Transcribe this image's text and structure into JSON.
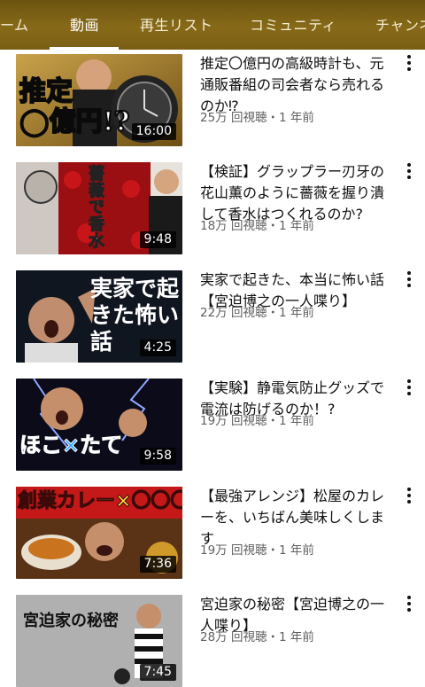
{
  "tabs": [
    {
      "label": "ーム"
    },
    {
      "label": "動画"
    },
    {
      "label": "再生リスト"
    },
    {
      "label": "コミュニティ"
    },
    {
      "label": "チャンネ"
    }
  ],
  "videos": [
    {
      "title": "推定〇億円の高級時計も、元通販番組の司会者なら売れるのか⁉",
      "meta": "25万 回視聴・1 年前",
      "duration": "16:00",
      "thumb_text": "推定\n◯億円!?"
    },
    {
      "title": "【検証】グラップラー刃牙の花山薫のように薔薇を握り潰して香水はつくれるのか?",
      "meta": "18万 回視聴・1 年前",
      "duration": "9:48",
      "thumb_text": "薔薇で香水"
    },
    {
      "title": "実家で起きた、本当に怖い話【宮迫博之の一人喋り】",
      "meta": "22万 回視聴・1 年前",
      "duration": "4:25",
      "thumb_text": "実家で起きた怖い話"
    },
    {
      "title": "【実験】静電気防止グッズで電流は防げるのか！?",
      "meta": "19万 回視聴・1 年前",
      "duration": "9:58",
      "thumb_text": "ほこ×たて"
    },
    {
      "title": "【最強アレンジ】松屋のカレーを、いちばん美味しくします",
      "meta": "19万 回視聴・1 年前",
      "duration": "7:36",
      "thumb_text": "創業カレー×〇〇〇"
    },
    {
      "title": "宮迫家の秘密【宮迫博之の一人喋り】",
      "meta": "28万 回視聴・1 年前",
      "duration": "7:45",
      "thumb_text": "宮迫家の秘密"
    }
  ],
  "colors": {
    "header": "#7a5e14",
    "title_text": "#0f0f0f",
    "meta_text": "#606060"
  }
}
